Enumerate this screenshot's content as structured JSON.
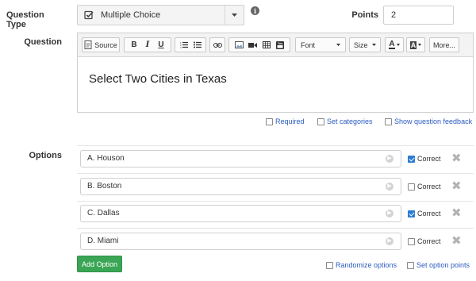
{
  "question_type": {
    "label": "Question Type",
    "value": "Multiple Choice",
    "icon": "check-square-icon"
  },
  "points": {
    "label": "Points",
    "value": "2"
  },
  "question": {
    "label": "Question",
    "text": "Select Two Cities in Texas",
    "toolbar": {
      "source_label": "Source",
      "bold": "B",
      "italic": "I",
      "underline": "U",
      "font_label": "Font",
      "size_label": "Size",
      "more_label": "More..."
    }
  },
  "question_settings": {
    "required": "Required",
    "set_categories": "Set categories",
    "show_feedback": "Show question feedback"
  },
  "options": {
    "label": "Options",
    "correct_label": "Correct",
    "items": [
      {
        "text": "A. Houson",
        "correct": true
      },
      {
        "text": "B. Boston",
        "correct": false
      },
      {
        "text": "C. Dallas",
        "correct": true
      },
      {
        "text": "D. Miami",
        "correct": false
      }
    ],
    "add_button": "Add Option",
    "randomize": "Randomize options",
    "set_points": "Set option points"
  },
  "colors": {
    "link": "#2b5bbf",
    "add_button": "#3aa655",
    "checkbox_checked": "#2b7cd3"
  }
}
